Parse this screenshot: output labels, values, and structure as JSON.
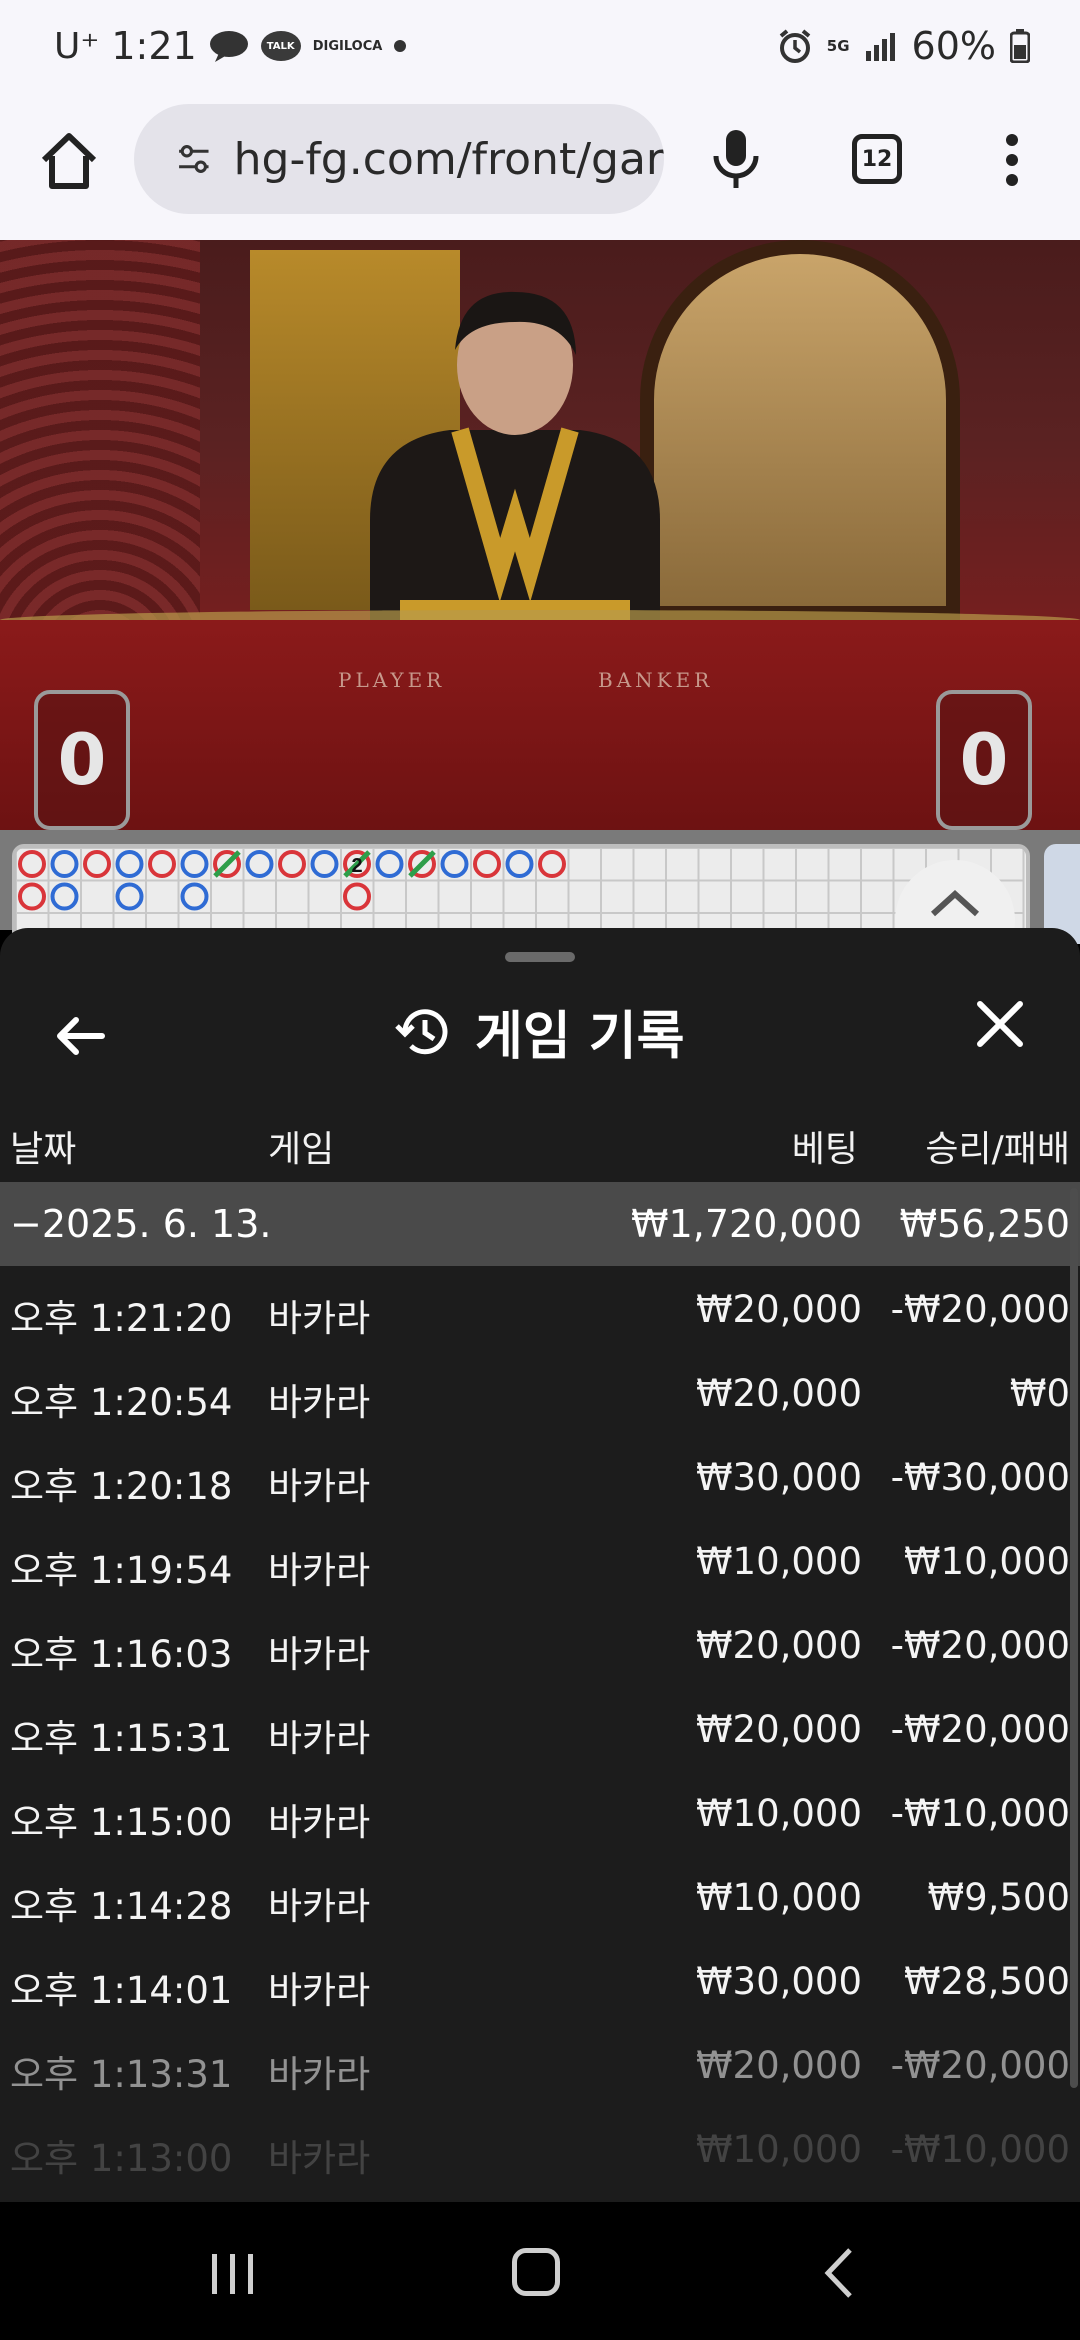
{
  "status_bar": {
    "carrier": "U⁺",
    "time": "1:21",
    "talk_label": "TALK",
    "digi_label_1": "DIGI",
    "digi_label_2": "LOCA",
    "network": "5G",
    "battery": "60%"
  },
  "browser": {
    "url": "hg-fg.com/front/gar",
    "tab_count": "12"
  },
  "video": {
    "player_label": "PLAYER",
    "banker_label": "BANKER",
    "player_score": "0",
    "banker_score": "0"
  },
  "roadmap": {
    "tie_count": "2",
    "top_row": [
      "R",
      "B",
      "R",
      "B",
      "R",
      "B",
      "R",
      "B",
      "R",
      "B",
      "R",
      "B",
      "R",
      "B",
      "R",
      "B",
      "R"
    ],
    "bottom_row": [
      "R",
      "B",
      "",
      "B",
      "",
      "B",
      "",
      "",
      "",
      "",
      "R",
      "",
      "",
      "",
      "",
      "",
      ""
    ]
  },
  "sheet": {
    "title": "게임 기록",
    "headers": {
      "date": "날짜",
      "game": "게임",
      "bet": "베팅",
      "result": "승리/패배"
    },
    "day": {
      "date": "−2025. 6. 13.",
      "bet": "₩1,720,000",
      "result": "₩56,250"
    },
    "rows": [
      {
        "time": "오후 1:21:20",
        "game": "바카라",
        "bet": "₩20,000",
        "result": "-₩20,000"
      },
      {
        "time": "오후 1:20:54",
        "game": "바카라",
        "bet": "₩20,000",
        "result": "₩0"
      },
      {
        "time": "오후 1:20:18",
        "game": "바카라",
        "bet": "₩30,000",
        "result": "-₩30,000"
      },
      {
        "time": "오후 1:19:54",
        "game": "바카라",
        "bet": "₩10,000",
        "result": "₩10,000"
      },
      {
        "time": "오후 1:16:03",
        "game": "바카라",
        "bet": "₩20,000",
        "result": "-₩20,000"
      },
      {
        "time": "오후 1:15:31",
        "game": "바카라",
        "bet": "₩20,000",
        "result": "-₩20,000"
      },
      {
        "time": "오후 1:15:00",
        "game": "바카라",
        "bet": "₩10,000",
        "result": "-₩10,000"
      },
      {
        "time": "오후 1:14:28",
        "game": "바카라",
        "bet": "₩10,000",
        "result": "₩9,500"
      },
      {
        "time": "오후 1:14:01",
        "game": "바카라",
        "bet": "₩30,000",
        "result": "₩28,500"
      },
      {
        "time": "오후 1:13:31",
        "game": "바카라",
        "bet": "₩20,000",
        "result": "-₩20,000"
      },
      {
        "time": "오후 1:13:00",
        "game": "바카라",
        "bet": "₩10,000",
        "result": "-₩10,000"
      }
    ]
  },
  "colors": {
    "banker_red": "#d9353a",
    "player_blue": "#2f6bd4",
    "tie_green": "#2e9e4a",
    "sheet_bg": "#1c1c1c",
    "day_row_bg": "#4a4a4a"
  },
  "icons": {
    "home": "home-icon",
    "site_settings": "tune-icon",
    "mic": "mic-icon",
    "menu": "more-vert-icon",
    "back": "arrow-left-icon",
    "history": "history-icon",
    "close": "close-icon",
    "expand": "chevron-up-icon"
  }
}
